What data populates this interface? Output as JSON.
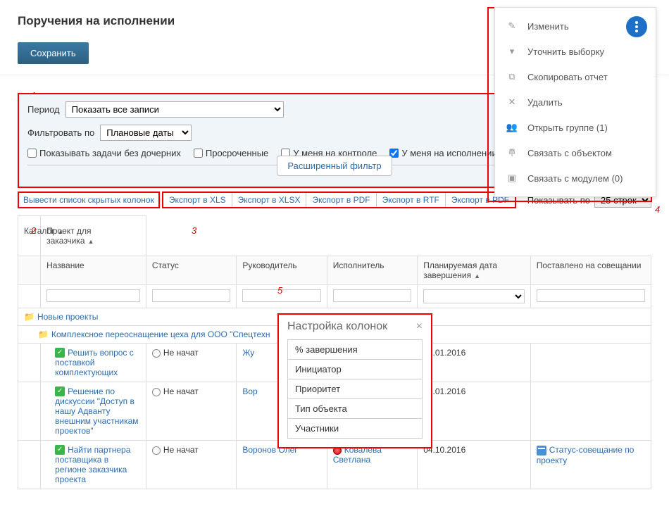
{
  "header": {
    "title": "Поручения на исполнении",
    "save_btn": "Сохранить"
  },
  "context_menu": {
    "items": [
      {
        "label": "Изменить",
        "icon": "pencil"
      },
      {
        "label": "Уточнить выборку",
        "icon": "funnel"
      },
      {
        "label": "Скопировать отчет",
        "icon": "copy"
      },
      {
        "label": "Удалить",
        "icon": "x"
      },
      {
        "label": "Открыть группе (1)",
        "icon": "group"
      },
      {
        "label": "Связать с объектом",
        "icon": "link"
      },
      {
        "label": "Связать с модулем (0)",
        "icon": "module"
      }
    ]
  },
  "filter": {
    "period_label": "Период",
    "period_value": "Показать все записи",
    "filterby_label": "Фильтровать по",
    "filterby_value": "Плановые даты",
    "checks": {
      "no_children": "Показывать задачи без дочерних",
      "overdue": "Просроченные",
      "on_control": "У меня на контроле",
      "on_execution": "У меня на исполнении"
    },
    "checked": {
      "on_execution": true
    },
    "adv_btn": "Расширенный фильтр"
  },
  "toolbar": {
    "show_hidden_cols": "Вывести список скрытых колонок",
    "exports": [
      "Экспорт в XLS",
      "Экспорт в XLSX",
      "Экспорт в PDF",
      "Экспорт в RTF",
      "Экспорт в PDF"
    ],
    "show_by_label": "Показывать по",
    "show_by_value": "25 строк"
  },
  "table": {
    "group_headers": [
      "Каталог",
      "Проект для заказчика"
    ],
    "columns": [
      "",
      "Название",
      "Статус",
      "Руководитель",
      "Исполнитель",
      "Планируемая дата завершения",
      "Поставлено на совещании"
    ],
    "groups": [
      {
        "level": 0,
        "label": "Новые проекты"
      },
      {
        "level": 1,
        "label": "Комплексное переоснащение цеха для ООО \"Спецтехн"
      }
    ],
    "rows": [
      {
        "title": "Решить вопрос с поставкой комплектующих",
        "status": "Не начат",
        "manager": "Жу",
        "executor": "",
        "plan_end": "01.01.2016",
        "meeting": ""
      },
      {
        "title": "Решение по дискуссии \"Доступ в нашу Адванту внешним участникам проектов\"",
        "status": "Не начат",
        "manager": "Вор",
        "executor": "",
        "plan_end": "01.01.2016",
        "meeting": ""
      },
      {
        "title": "Найти партнера поставщика в регионе заказчика проекта",
        "status": "Не начат",
        "manager": "Воронов Олег",
        "executor": "Ковалева Светлана",
        "executor_red": true,
        "plan_end": "04.10.2016",
        "meeting": "Статус-совещание по проекту"
      }
    ]
  },
  "col_config": {
    "title": "Настройка колонок",
    "items": [
      "% завершения",
      "Инициатор",
      "Приоритет",
      "Тип объекта",
      "Участники"
    ]
  },
  "annotations": {
    "1": "1",
    "2": "2",
    "3": "3",
    "4": "4",
    "5": "5"
  }
}
